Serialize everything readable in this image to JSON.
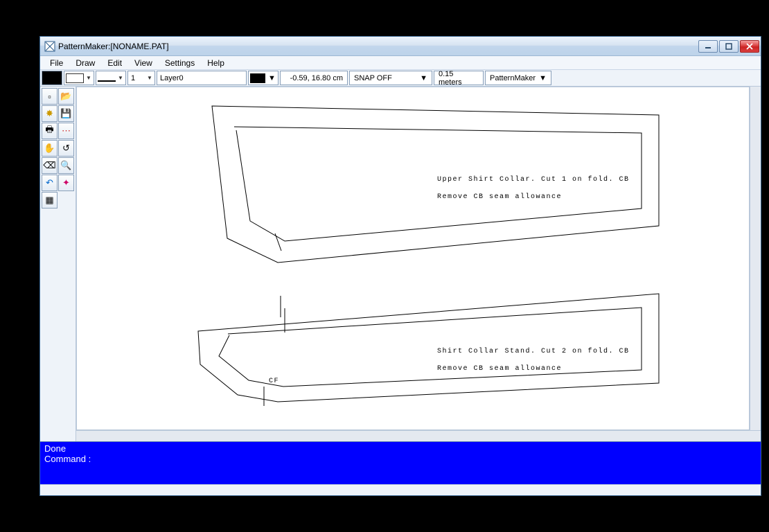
{
  "window": {
    "title": "PatternMaker:[NONAME.PAT]"
  },
  "menu": {
    "items": [
      "File",
      "Draw",
      "Edit",
      "View",
      "Settings",
      "Help"
    ]
  },
  "optionsbar": {
    "line_weight": "1",
    "layer_name": "Layer0",
    "coords": "-0.59, 16.80 cm",
    "snap": "SNAP OFF",
    "meters": "0.15 meters",
    "appmode": "PatternMaker"
  },
  "toolbar": {
    "icons": [
      [
        "new-icon",
        "open-icon"
      ],
      [
        "run-icon",
        "save-icon"
      ],
      [
        "print-icon",
        "grid-icon"
      ],
      [
        "pan-icon",
        "reload-icon"
      ],
      [
        "erase-icon",
        "zoom-icon"
      ],
      [
        "undo-icon",
        "explode-icon"
      ],
      [
        "calc-icon",
        null
      ]
    ],
    "glyphs": {
      "new-icon": "▫",
      "open-icon": "📂",
      "run-icon": "✸",
      "save-icon": "💾",
      "print-icon": "🖶",
      "grid-icon": "⋯",
      "pan-icon": "✋",
      "reload-icon": "↺",
      "erase-icon": "⌫",
      "zoom-icon": "🔍",
      "undo-icon": "↶",
      "explode-icon": "✦",
      "calc-icon": "▦"
    }
  },
  "canvas": {
    "labels": {
      "upper1": "Upper Shirt Collar. Cut 1 on fold. CB",
      "upper2": "Remove CB seam allowance",
      "stand1": "Shirt Collar Stand. Cut 2 on fold. CB",
      "stand2": "Remove CB seam allowance",
      "cf": "CF"
    }
  },
  "command": {
    "line1": "Done",
    "line2": "Command :"
  }
}
